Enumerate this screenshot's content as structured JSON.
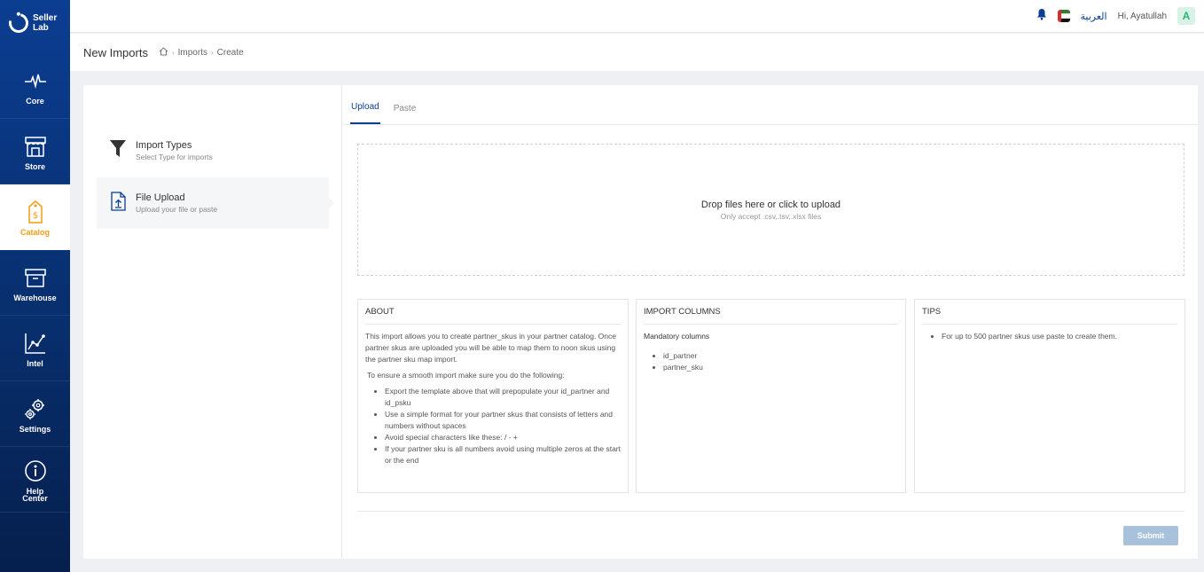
{
  "brand": {
    "line1": "Seller",
    "line2": "Lab"
  },
  "sidebar": {
    "items": [
      {
        "label": "Core",
        "icon": "pulse-icon"
      },
      {
        "label": "Store",
        "icon": "storefront-icon"
      },
      {
        "label": "Catalog",
        "icon": "price-tag-icon"
      },
      {
        "label": "Warehouse",
        "icon": "box-icon"
      },
      {
        "label": "Intel",
        "icon": "line-chart-icon"
      },
      {
        "label": "Settings",
        "icon": "gears-icon"
      },
      {
        "label": "Help Center",
        "icon": "info-icon"
      }
    ],
    "active": "Catalog",
    "active_color": "#f39c12"
  },
  "topbar": {
    "language": "العربية",
    "greeting": "Hi, Ayatullah",
    "avatar_initial": "A"
  },
  "header": {
    "title": "New Imports",
    "breadcrumb": [
      "Imports",
      "Create"
    ]
  },
  "steps": [
    {
      "title": "Import Types",
      "subtitle": "Select Type for imports"
    },
    {
      "title": "File Upload",
      "subtitle": "Upload your file or paste"
    }
  ],
  "tabs": [
    {
      "label": "Upload"
    },
    {
      "label": "Paste"
    }
  ],
  "dropzone": {
    "title": "Drop files here or click to upload",
    "subtitle": "Only accept .csv,.tsv,.xlsx files"
  },
  "about": {
    "heading": "ABOUT",
    "intro": "This import allows you to create partner_skus in your partner catalog. Once partner skus are uploaded you will be able to map them to noon skus using the partner sku map import.",
    "ensure": "To ensure a smooth import make sure you do the following:",
    "bullets": [
      "Export the template above that will prepopulate your id_partner and id_psku",
      "Use a simple format for your partner skus that consists of letters and numbers without spaces",
      "Avoid special characters like these: / - +",
      "If your partner sku is all numbers avoid using multiple zeros at the start or the end"
    ]
  },
  "import_columns": {
    "heading": "IMPORT COLUMNS",
    "mandatory_label": "Mandatory columns",
    "columns": [
      "id_partner",
      "partner_sku"
    ]
  },
  "tips": {
    "heading": "TIPS",
    "items": [
      "For up to 500 partner skus use paste to create them."
    ]
  },
  "actions": {
    "submit_label": "Submit"
  },
  "colors": {
    "sidebar": "#0b3d91",
    "accent": "#f39c12",
    "submit_disabled": "#a9c2dc"
  }
}
